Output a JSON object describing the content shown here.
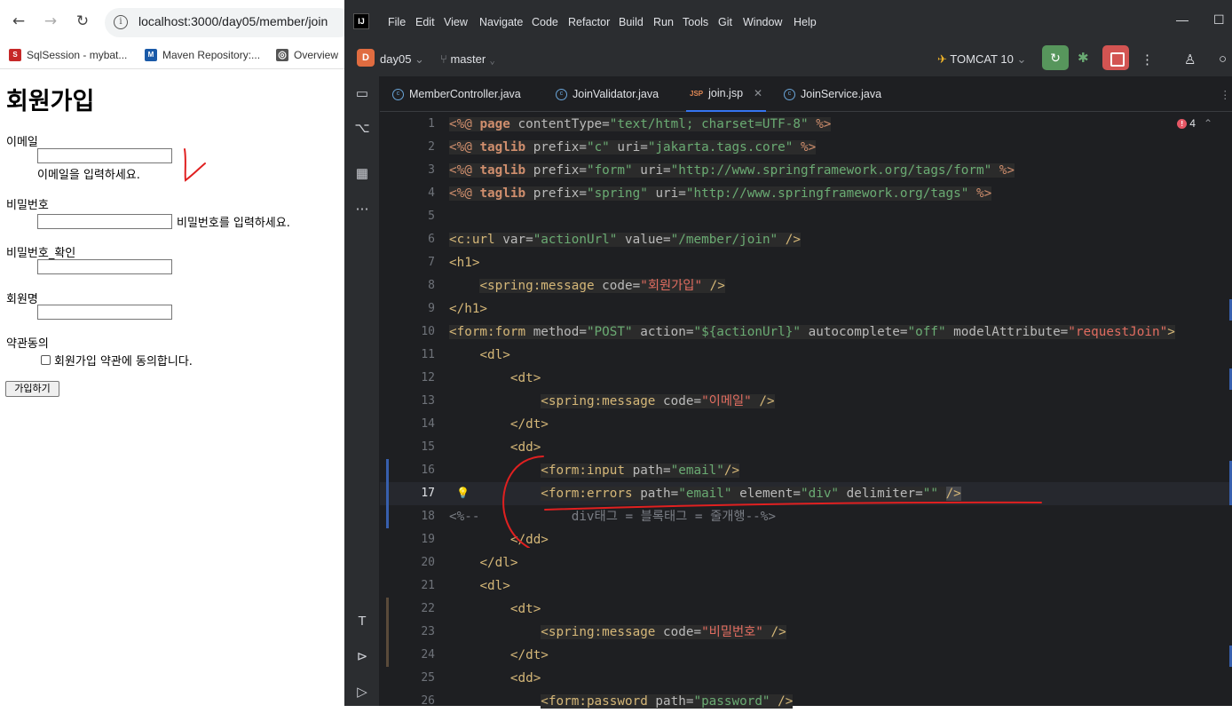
{
  "browser": {
    "url": "localhost:3000/day05/member/join",
    "nav": {
      "back": "←",
      "forward": "→",
      "reload": "↻",
      "info": "i"
    },
    "bookmarks": [
      {
        "label": "SqlSession - mybat...",
        "icon": "S",
        "color": "#c62828"
      },
      {
        "label": "Maven Repository:...",
        "icon": "M",
        "color": "#1a5aa8"
      },
      {
        "label": "Overview",
        "icon": "◎",
        "color": "#555555"
      }
    ]
  },
  "page": {
    "title": "회원가입",
    "email_label": "이메일",
    "email_hint": "이메일을 입력하세요.",
    "password_label": "비밀번호",
    "password_hint": "비밀번호를 입력하세요.",
    "password_confirm_label": "비밀번호_확인",
    "name_label": "회원명",
    "terms_label": "약관동의",
    "terms_agree": "회원가입 약관에 동의합니다.",
    "submit": "가입하기"
  },
  "ide": {
    "logo": "IJ",
    "menu": [
      "File",
      "Edit",
      "View",
      "Navigate",
      "Code",
      "Refactor",
      "Build",
      "Run",
      "Tools",
      "Git",
      "Window",
      "Help"
    ],
    "project_badge": "D",
    "project": "day05",
    "branch": "master",
    "run_config": "TOMCAT 10",
    "problems_count": "4",
    "tabs": [
      {
        "label": "MemberController.java",
        "type": "java"
      },
      {
        "label": "JoinValidator.java",
        "type": "java"
      },
      {
        "label": "join.jsp",
        "type": "jsp"
      },
      {
        "label": "JoinService.java",
        "type": "java"
      }
    ],
    "line_numbers": [
      "1",
      "2",
      "3",
      "4",
      "5",
      "6",
      "7",
      "8",
      "9",
      "10",
      "11",
      "12",
      "13",
      "14",
      "15",
      "16",
      "17",
      "18",
      "19",
      "20",
      "21",
      "22",
      "23",
      "24",
      "25",
      "26"
    ]
  },
  "colors": {
    "accent": "#3574f0",
    "run_green": "#57965c",
    "stop_red": "#d35452",
    "annotation_red": "#e02020"
  }
}
